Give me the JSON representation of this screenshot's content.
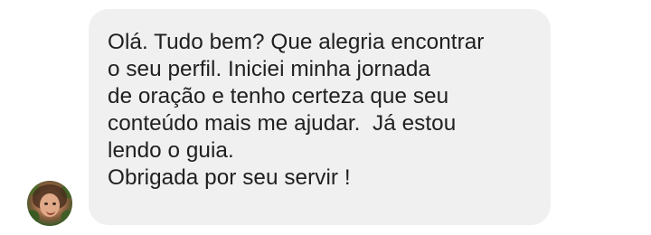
{
  "message": {
    "text": "Olá. Tudo bem? Que alegria encontrar\no seu perfil. Iniciei minha jornada\nde oração e tenho certeza que seu\nconteúdo mais me ajudar.  Já estou\nlendo o guia.\nObrigada por seu servir !"
  },
  "avatar": {
    "icon": "profile-photo"
  },
  "colors": {
    "bubble_background": "#f0f0f0",
    "text": "#202020"
  }
}
